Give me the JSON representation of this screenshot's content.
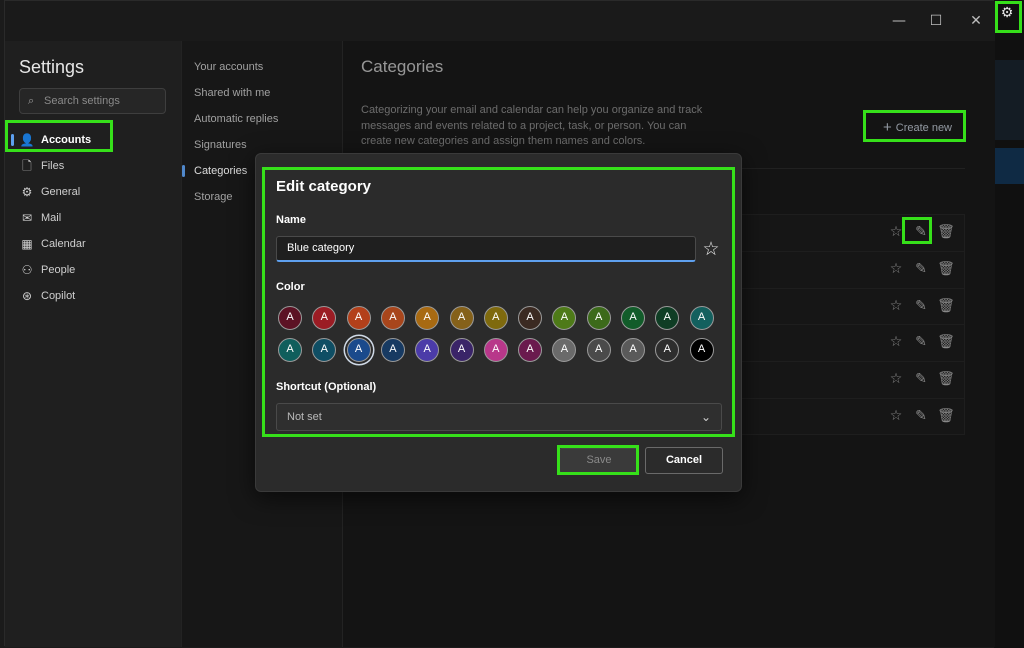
{
  "window": {
    "controls": {
      "minimize": "—",
      "maximize": "☐",
      "close": "✕"
    },
    "settings_gear": "⚙"
  },
  "leftnav": {
    "title": "Settings",
    "search_placeholder": "Search settings",
    "items": [
      {
        "label": "Accounts",
        "icon": "person-icon",
        "glyph": "👤"
      },
      {
        "label": "Files",
        "icon": "file-icon",
        "glyph": "🗋"
      },
      {
        "label": "General",
        "icon": "gear-icon",
        "glyph": "⚙"
      },
      {
        "label": "Mail",
        "icon": "mail-icon",
        "glyph": "✉"
      },
      {
        "label": "Calendar",
        "icon": "calendar-icon",
        "glyph": "▦"
      },
      {
        "label": "People",
        "icon": "people-icon",
        "glyph": "⚇"
      },
      {
        "label": "Copilot",
        "icon": "copilot-icon",
        "glyph": "⊛"
      }
    ],
    "active_index": 0
  },
  "midnav": {
    "items": [
      "Your accounts",
      "Shared with me",
      "Automatic replies",
      "Signatures",
      "Categories",
      "Storage"
    ],
    "active_index": 4
  },
  "main": {
    "title": "Categories",
    "description": "Categorizing your email and calendar can help you organize and track messages and events related to a project, task, or person. You can create new categories and assign them names and colors.",
    "create_new_label": "Create new",
    "row_count": 6
  },
  "dialog": {
    "title": "Edit category",
    "name_label": "Name",
    "name_value": "Blue category",
    "color_label": "Color",
    "swatch_letter": "A",
    "swatch_colors": [
      "#5c1224",
      "#9b1c24",
      "#b3401a",
      "#a8461c",
      "#a86a12",
      "#85611a",
      "#7f6a0e",
      "#3b2a22",
      "#4e7a18",
      "#3c6a1a",
      "#125c2a",
      "#0f3d24",
      "#13605e",
      "#0f5e5c",
      "#0f4e64",
      "#1a4a8c",
      "#173a62",
      "#4b3ba8",
      "#3a2468",
      "#b8378a",
      "#6a1a4e",
      "#6a6a6a",
      "#4a4a4a",
      "#5a5a5a",
      "#2e2e2e",
      "#000000"
    ],
    "selected_swatch_index": 15,
    "shortcut_label": "Shortcut (Optional)",
    "shortcut_value": "Not set",
    "save_label": "Save",
    "cancel_label": "Cancel"
  },
  "highlight_color": "#36e01a"
}
